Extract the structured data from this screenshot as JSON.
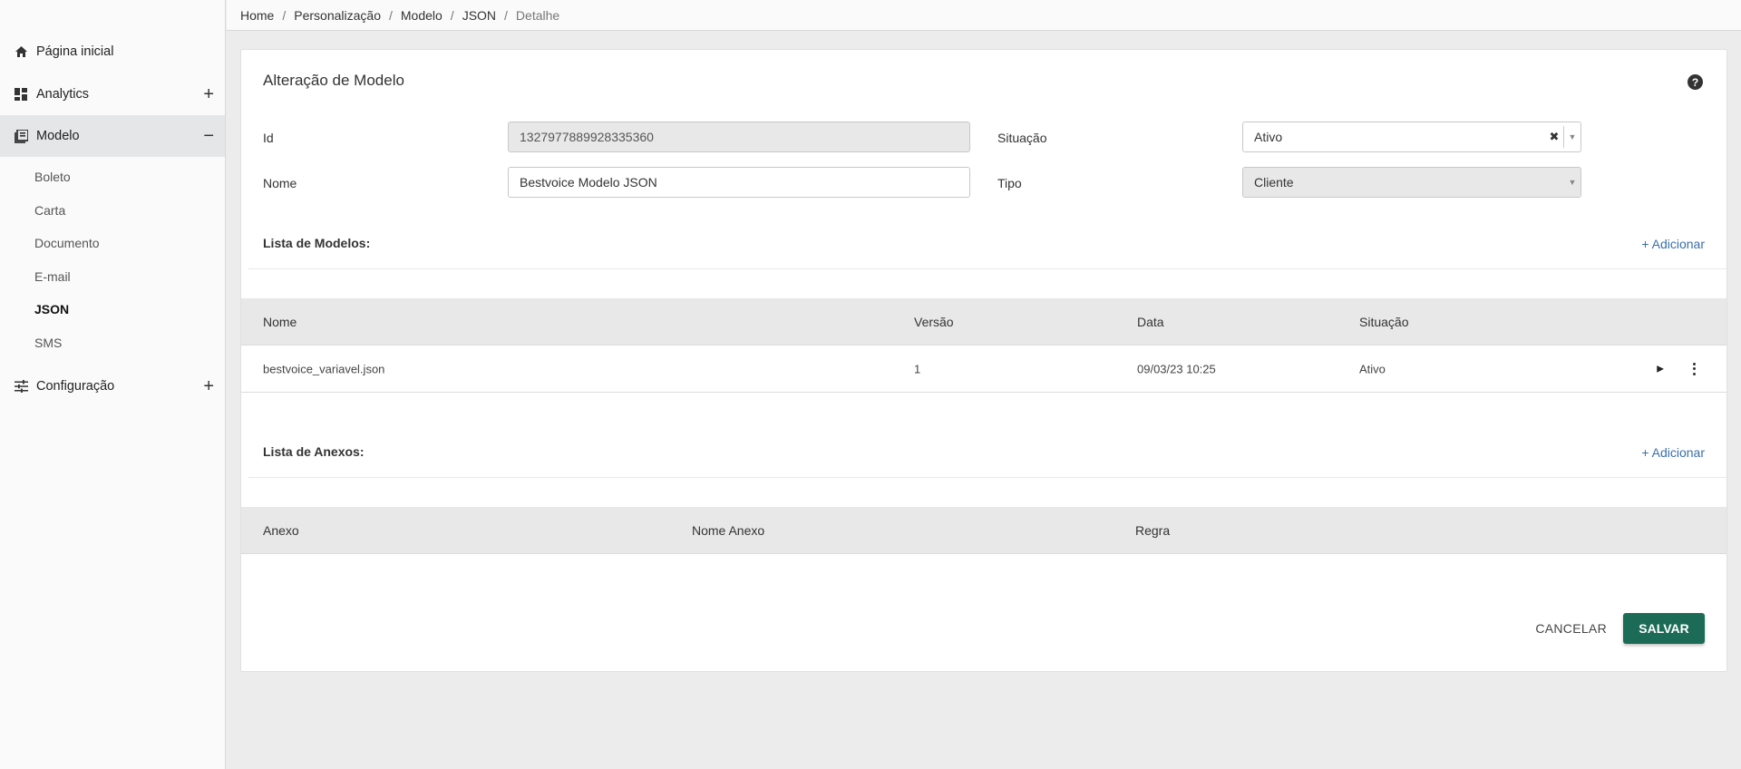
{
  "breadcrumb": {
    "items": [
      "Home",
      "Personalização",
      "Modelo",
      "JSON"
    ],
    "current": "Detalhe"
  },
  "sidebar": {
    "home": "Página inicial",
    "analytics": "Analytics",
    "modelo": "Modelo",
    "sub_items": [
      "Boleto",
      "Carta",
      "Documento",
      "E-mail",
      "JSON",
      "SMS"
    ],
    "current_sub": "JSON",
    "configuracao": "Configuração",
    "expand_symbol": "+",
    "collapse_symbol": "−"
  },
  "form": {
    "title": "Alteração de Modelo",
    "help_symbol": "?",
    "id_label": "Id",
    "id_value": "1327977889928335360",
    "nome_label": "Nome",
    "nome_value": "Bestvoice Modelo JSON",
    "situacao_label": "Situação",
    "situacao_value": "Ativo",
    "tipo_label": "Tipo",
    "tipo_value": "Cliente"
  },
  "modelos": {
    "title": "Lista de Modelos:",
    "add_label": "+ Adicionar",
    "headers": [
      "Nome",
      "Versão",
      "Data",
      "Situação"
    ],
    "rows": [
      {
        "nome": "bestvoice_variavel.json",
        "versao": "1",
        "data": "09/03/23 10:25",
        "situacao": "Ativo"
      }
    ]
  },
  "anexos": {
    "title": "Lista de Anexos:",
    "add_label": "+ Adicionar",
    "headers": [
      "Anexo",
      "Nome Anexo",
      "Regra"
    ]
  },
  "actions": {
    "cancel": "CANCELAR",
    "save": "SALVAR"
  },
  "colors": {
    "primary": "#1c6b57",
    "link": "#3a6fa8"
  }
}
